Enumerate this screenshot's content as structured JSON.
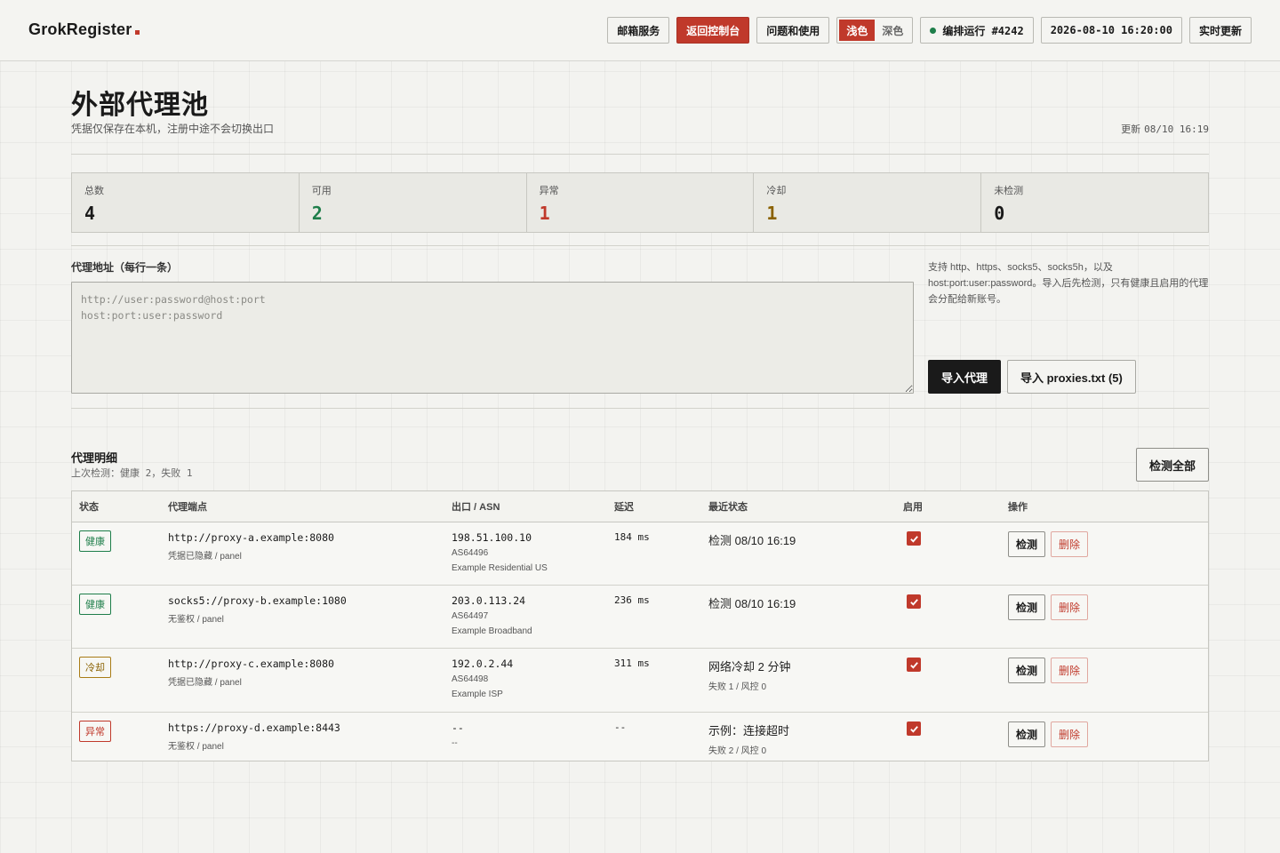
{
  "header": {
    "brand": "GrokRegister",
    "nav": {
      "mail": "邮箱服务",
      "back": "返回控制台",
      "help": "问题和使用",
      "theme_light": "浅色",
      "theme_dark": "深色",
      "build": "编排运行 #4242",
      "datetime": "2026-08-10 16:20:00",
      "live": "实时更新"
    }
  },
  "colors": {
    "accent": "#c0392b",
    "healthy": "#1e7e4a",
    "cooldown": "#8a6100",
    "error": "#c0392b"
  },
  "page": {
    "title": "外部代理池",
    "subtitle": "凭据仅保存在本机，注册中途不会切换出口",
    "updated_label": "更新",
    "updated_value": "08/10 16:19"
  },
  "stats": [
    {
      "label": "总数",
      "value": "4",
      "color": "#1a1a1a"
    },
    {
      "label": "可用",
      "value": "2",
      "color": "#1e7e4a"
    },
    {
      "label": "异常",
      "value": "1",
      "color": "#c0392b"
    },
    {
      "label": "冷却",
      "value": "1",
      "color": "#8a6100"
    },
    {
      "label": "未检测",
      "value": "0",
      "color": "#1a1a1a"
    }
  ],
  "import": {
    "label": "代理地址（每行一条）",
    "placeholder": "http://user:password@host:port\nhost:port:user:password",
    "help": "支持 http、https、socks5、socks5h，以及 host:port:user:password。导入后先检测，只有健康且启用的代理会分配给新账号。",
    "import_button": "导入代理",
    "file_button": "导入 proxies.txt (5)"
  },
  "details": {
    "title": "代理明细",
    "last_check_label": "上次检测：",
    "last_check_value": "健康 2，失败 1",
    "check_all": "检测全部",
    "columns": [
      "状态",
      "代理端点",
      "出口 / ASN",
      "延迟",
      "最近状态",
      "启用",
      "操作"
    ],
    "rows": [
      {
        "status": "健康",
        "status_kind": "ok",
        "endpoint": "http://proxy-a.example:8080",
        "auth": "凭据已隐藏 / panel",
        "ip": "198.51.100.10",
        "asn": "AS64496",
        "org": "Example Residential US",
        "latency": "184 ms",
        "recent": "检测 08/10 16:19",
        "recent_sub": "",
        "enabled": true,
        "check": "检测",
        "delete": "删除"
      },
      {
        "status": "健康",
        "status_kind": "ok",
        "endpoint": "socks5://proxy-b.example:1080",
        "auth": "无鉴权 / panel",
        "ip": "203.0.113.24",
        "asn": "AS64497",
        "org": "Example Broadband",
        "latency": "236 ms",
        "recent": "检测 08/10 16:19",
        "recent_sub": "",
        "enabled": true,
        "check": "检测",
        "delete": "删除"
      },
      {
        "status": "冷却",
        "status_kind": "cool",
        "endpoint": "http://proxy-c.example:8080",
        "auth": "凭据已隐藏 / panel",
        "ip": "192.0.2.44",
        "asn": "AS64498",
        "org": "Example ISP",
        "latency": "311 ms",
        "recent": "网络冷却 2 分钟",
        "recent_sub": "失败 1 / 风控 0",
        "enabled": true,
        "check": "检测",
        "delete": "删除"
      },
      {
        "status": "异常",
        "status_kind": "err",
        "endpoint": "https://proxy-d.example:8443",
        "auth": "无鉴权 / panel",
        "ip": "--",
        "asn": "--",
        "org": "",
        "latency": "--",
        "recent": "示例：连接超时",
        "recent_sub": "失败 2 / 风控 0",
        "enabled": true,
        "check": "检测",
        "delete": "删除"
      }
    ]
  }
}
